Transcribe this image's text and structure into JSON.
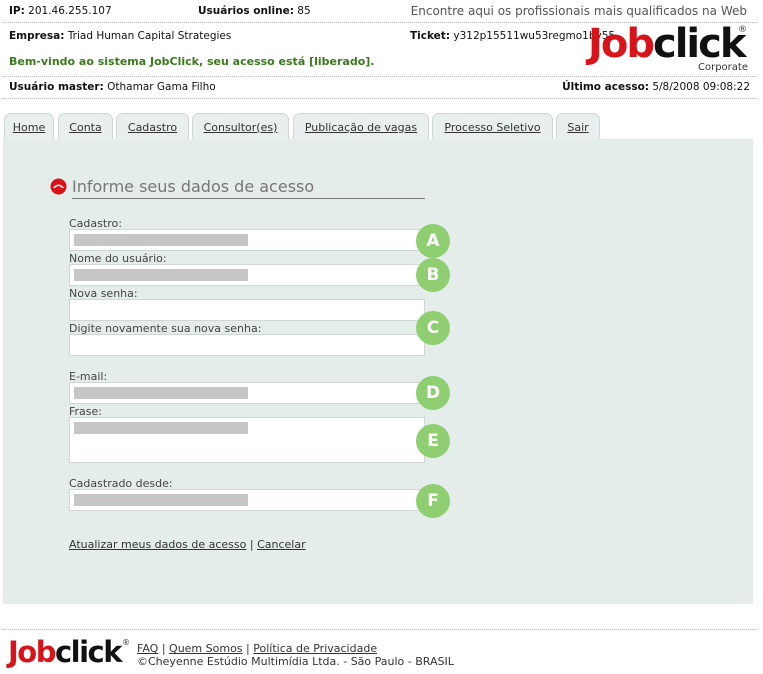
{
  "header": {
    "ip_label": "IP:",
    "ip_value": "201.46.255.107",
    "users_online_label": "Usuários online:",
    "users_online_value": "85",
    "tagline": "Encontre aqui os profissionais mais qualificados na Web",
    "company_label": "Empresa:",
    "company_value": "Triad Human Capital Strategies",
    "ticket_label": "Ticket:",
    "ticket_value": "y312p15511wu53regmo1by55",
    "welcome": "Bem-vindo ao sistema JobClick, seu acesso está [liberado].",
    "master_user_label": "Usuário master:",
    "master_user_value": "Othamar Gama Filho",
    "last_access_label": "Último acesso:",
    "last_access_value": "5/8/2008 09:08:22"
  },
  "logo": {
    "job": "Job",
    "click": "click",
    "registered": "®",
    "subtitle": "Corporate"
  },
  "tabs": [
    {
      "label": "Home"
    },
    {
      "label": "Conta"
    },
    {
      "label": "Cadastro"
    },
    {
      "label": "Consultor(es)"
    },
    {
      "label": "Publicação de vagas"
    },
    {
      "label": "Processo Seletivo"
    },
    {
      "label": "Sair"
    }
  ],
  "form": {
    "title": "Informe seus dados de acesso",
    "fields": {
      "cadastro": {
        "label": "Cadastro:"
      },
      "username": {
        "label": "Nome do usuário:"
      },
      "new_password": {
        "label": "Nova senha:"
      },
      "confirm_password": {
        "label": "Digite novamente sua nova senha:"
      },
      "email": {
        "label": "E-mail:"
      },
      "phrase": {
        "label": "Frase:"
      },
      "registered_since": {
        "label": "Cadastrado desde:"
      }
    },
    "badges": [
      "A",
      "B",
      "C",
      "D",
      "E",
      "F"
    ],
    "update_link": "Atualizar meus dados de acesso",
    "separator": "|",
    "cancel_link": "Cancelar"
  },
  "footer": {
    "logo_job": "Job",
    "logo_click": "click",
    "logo_registered": "®",
    "faq": "FAQ",
    "about": "Quem Somos",
    "privacy": "Política de Privacidade",
    "separator": "|",
    "copyright": "©Cheyenne Estúdio Multimídia Ltda. - São Paulo - BRASIL"
  },
  "colors": {
    "brand_red": "#d7141a",
    "welcome_green": "#3a7a1d",
    "badge_green": "#8fcf71",
    "panel_bg": "#e5edeb"
  }
}
